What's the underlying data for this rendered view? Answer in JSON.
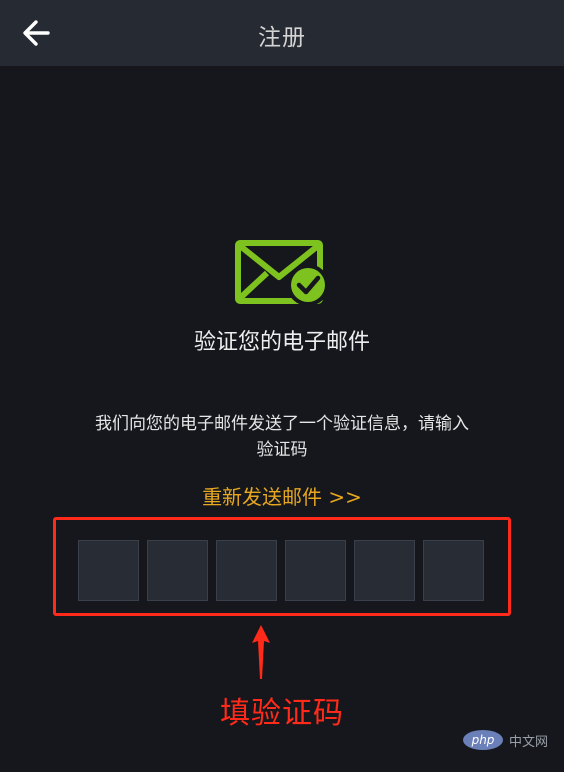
{
  "header": {
    "title": "注册",
    "back_icon": "arrow-left-icon"
  },
  "main": {
    "mail_icon": "mail-check-icon",
    "mail_icon_color": "#7dc21e",
    "heading": "验证您的电子邮件",
    "description_line1": "我们向您的电子邮件发送了一个验证信息，请输入",
    "description_line2": "验证码",
    "resend_link": "重新发送邮件 >>",
    "code_boxes": [
      "",
      "",
      "",
      "",
      "",
      ""
    ]
  },
  "annotation": {
    "label": "填验证码",
    "color": "#ff2a1a"
  },
  "watermark": {
    "logo_text": "php",
    "site_text": "中文网"
  },
  "colors": {
    "background": "#15171c",
    "header": "#262a33",
    "accent": "#e7a71f"
  }
}
